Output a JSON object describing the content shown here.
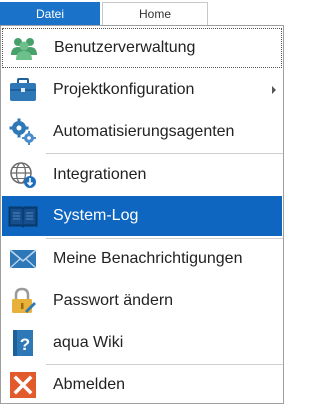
{
  "tabs": {
    "file": "Datei",
    "home": "Home"
  },
  "menu": {
    "items": [
      {
        "label": "Benutzerverwaltung",
        "icon": "users-icon"
      },
      {
        "label": "Projektkonfiguration",
        "icon": "briefcase-icon"
      },
      {
        "label": "Automatisierungsagenten",
        "icon": "gears-icon"
      },
      {
        "label": "Integrationen",
        "icon": "globe-icon"
      },
      {
        "label": "System-Log",
        "icon": "log-book-icon"
      },
      {
        "label": "Meine Benachrichtigungen",
        "icon": "envelope-icon"
      },
      {
        "label": "Passwort ändern",
        "icon": "lock-icon"
      },
      {
        "label": "aqua Wiki",
        "icon": "help-book-icon"
      },
      {
        "label": "Abmelden",
        "icon": "logout-x-icon"
      }
    ]
  },
  "colors": {
    "accent": "#0f66c0",
    "tab": "#1a73c9",
    "logout": "#e25a2c"
  }
}
